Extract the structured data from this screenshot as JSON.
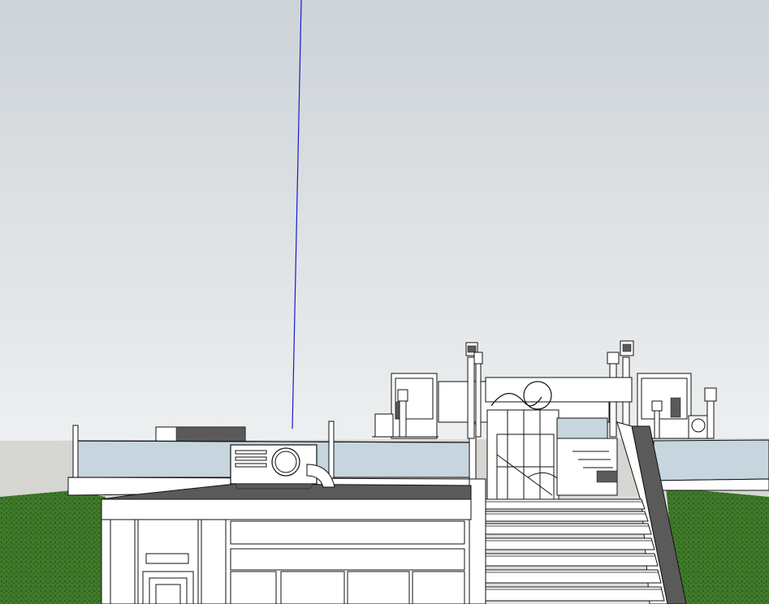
{
  "app": {
    "view": "3d-model-viewport"
  },
  "colors": {
    "sky_top": "#cdd3d8",
    "sky_bottom": "#eef0f1",
    "ground_far": "#d6d6d2",
    "grass": "#3f7a2a",
    "grass_dark": "#2a5a1b",
    "wall_fill": "#ffffff",
    "line": "#111111",
    "glass": "#c6d5de",
    "shadow_roof": "#5a5a5a",
    "axis_blue": "#1a1acc"
  },
  "scene": {
    "objects": [
      "blue-axis",
      "grass-ground",
      "glass-railing",
      "roof-canopy",
      "hvac-unit",
      "duct-elbow",
      "staircase",
      "gate",
      "lamp-posts",
      "pergola-left",
      "pergola-right",
      "building-facade"
    ]
  }
}
